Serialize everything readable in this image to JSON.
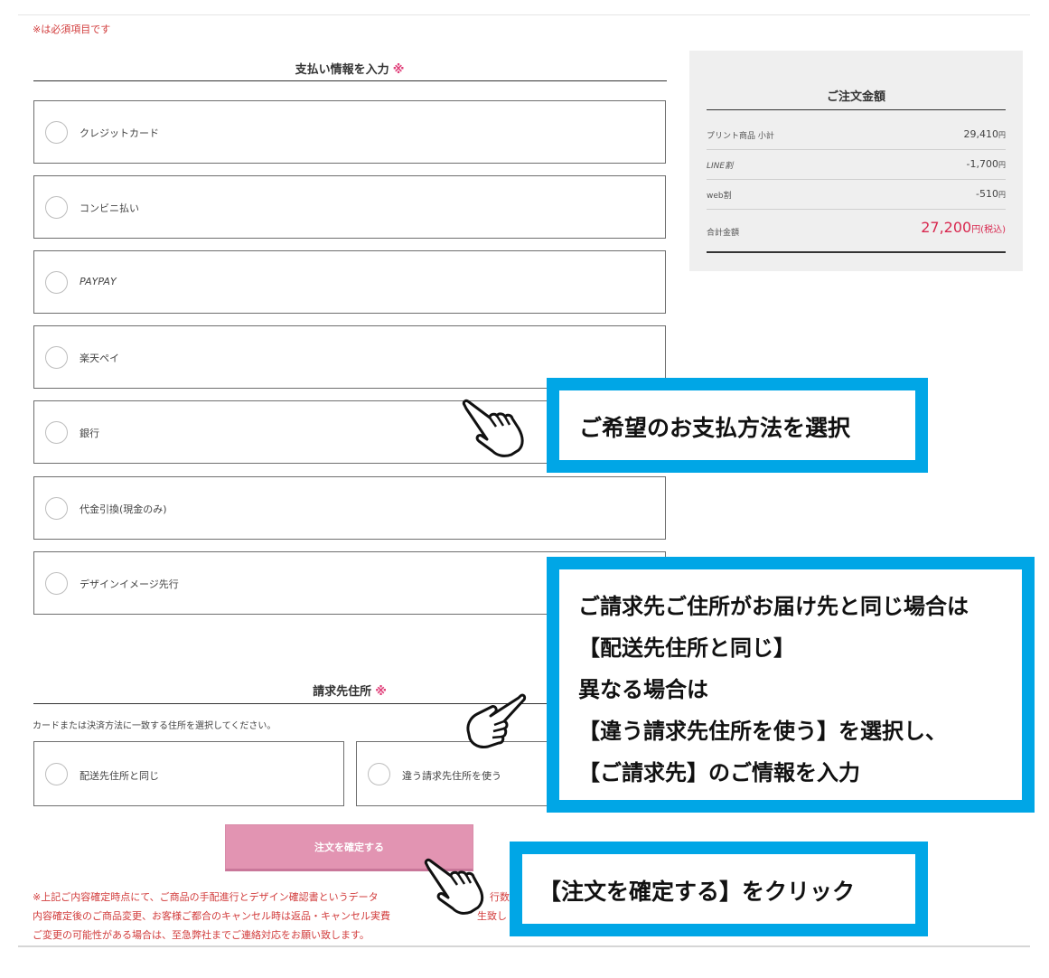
{
  "required_note": "※は必須項目です",
  "payment_section": {
    "title": "支払い情報を入力",
    "required_mark": "※",
    "options": [
      {
        "label": "クレジットカード"
      },
      {
        "label": "コンビニ払い"
      },
      {
        "label": "PAYPAY"
      },
      {
        "label": "楽天ペイ"
      },
      {
        "label": "銀行"
      },
      {
        "label": "代金引換(現金のみ)"
      },
      {
        "label": "デザインイメージ先行"
      }
    ]
  },
  "order_summary": {
    "title": "ご注文金額",
    "rows": [
      {
        "label": "プリント商品 小計",
        "value": "29,410",
        "unit": "円"
      },
      {
        "label": "LINE割",
        "value": "-1,700",
        "unit": "円"
      },
      {
        "label": "web割",
        "value": "-510",
        "unit": "円"
      }
    ],
    "total": {
      "label": "合計金額",
      "value": "27,200",
      "unit": "円(税込)"
    }
  },
  "billing_section": {
    "title": "請求先住所",
    "required_mark": "※",
    "note": "カードまたは決済方法に一致する住所を選択してください。",
    "options": [
      {
        "label": "配送先住所と同じ"
      },
      {
        "label": "違う請求先住所を使う"
      }
    ]
  },
  "confirm_button": {
    "label": "注文を確定する"
  },
  "notice_lines": [
    "※上記ご内容確定時点にて、ご商品の手配進行とデザイン確認書というデータ",
    "内容確定後のご商品変更、お客様ご都合のキャンセル時は返品・キャンセル実費",
    "ご変更の可能性がある場合は、至急弊社までご連絡対応をお願い致します。"
  ],
  "notice_tail": {
    "line1": "行数",
    "line2": "生致し"
  },
  "callouts": {
    "payment": "ご希望のお支払方法を選択",
    "billing_lines": [
      "ご請求先ご住所がお届け先と同じ場合は",
      "【配送先住所と同じ】",
      "異なる場合は",
      "【違う請求先住所を使う】を選択し、",
      "【ご請求先】のご情報を入力"
    ],
    "confirm": "【注文を確定する】をクリック"
  },
  "colors": {
    "callout_border": "#00a6e6",
    "required": "#d23c3c",
    "button": "#e294b2",
    "total": "#d8284f"
  },
  "icons": [
    "pointing-hand-icon"
  ]
}
